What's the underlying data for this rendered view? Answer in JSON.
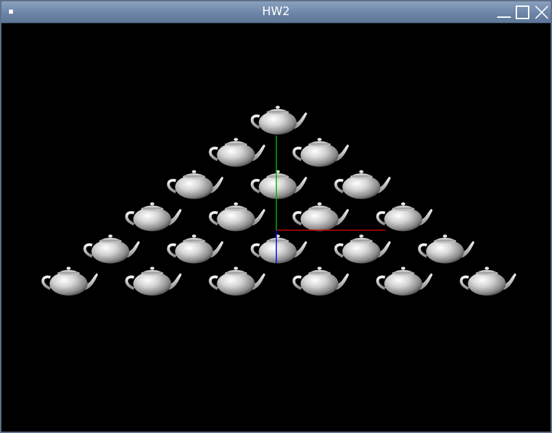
{
  "window": {
    "title": "HW2",
    "controls": [
      "minimize-icon",
      "maximize-icon",
      "close-icon"
    ],
    "colors": {
      "titlebar": "#6d86a8",
      "background": "#000000"
    }
  },
  "scene": {
    "object": "teapot",
    "rows": [
      1,
      2,
      3,
      4,
      5,
      6
    ],
    "axes": {
      "x_color": "#cc0000",
      "y_color": "#00cc00",
      "z_color": "#0000ff"
    }
  }
}
